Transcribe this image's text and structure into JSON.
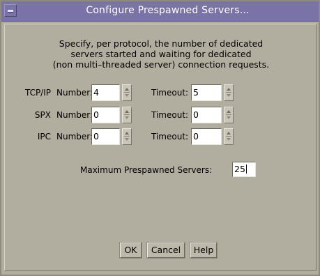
{
  "window": {
    "title": "Configure Prespawned Servers..."
  },
  "description": [
    "Specify, per protocol, the number of dedicated",
    "servers started and waiting for dedicated",
    "(non multi–threaded server) connection requests."
  ],
  "labels": {
    "number": "Number:",
    "timeout": "Timeout:",
    "max_prespawned": "Maximum Prespawned Servers:"
  },
  "protocols": [
    {
      "name": "TCP/IP",
      "number": "4",
      "timeout": "5"
    },
    {
      "name": "SPX",
      "number": "0",
      "timeout": "0"
    },
    {
      "name": "IPC",
      "number": "0",
      "timeout": "0"
    }
  ],
  "max_prespawned_value": "25",
  "buttons": {
    "ok": "OK",
    "cancel": "Cancel",
    "help": "Help"
  },
  "colors": {
    "titlebar": "#7a73a8",
    "window_bg": "#b1ad9f",
    "field_bg": "#ffffff"
  },
  "icons": {
    "window_menu": "window-menu-icon",
    "spin_up": "spin-up-arrow-icon",
    "spin_down": "spin-down-arrow-icon"
  }
}
